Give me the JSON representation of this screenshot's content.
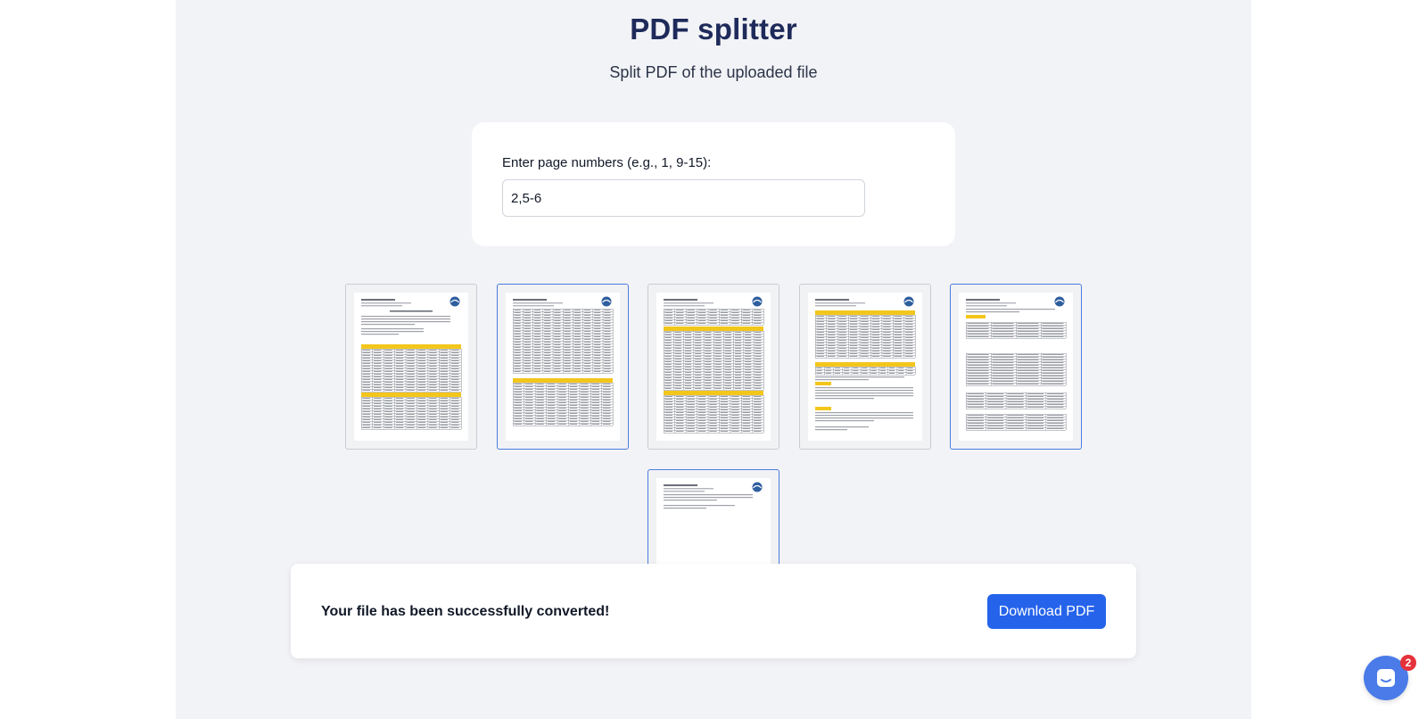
{
  "header": {
    "title": "PDF splitter",
    "subtitle": "Split PDF of the uploaded file"
  },
  "form": {
    "label": "Enter page numbers (e.g., 1, 9-15):",
    "value": "2,5-6"
  },
  "pages": [
    {
      "page": 1,
      "selected": false
    },
    {
      "page": 2,
      "selected": true
    },
    {
      "page": 3,
      "selected": false
    },
    {
      "page": 4,
      "selected": false
    },
    {
      "page": 5,
      "selected": true
    },
    {
      "page": 6,
      "selected": true
    }
  ],
  "result": {
    "message": "Your file has been successfully converted!",
    "download_label": "Download PDF"
  },
  "chat": {
    "badge_count": "2",
    "icon": "chat-icon"
  },
  "colors": {
    "accent": "#2563eb",
    "title": "#1e2a5a",
    "selected_border": "#4b7be0",
    "doc_highlight": "#f3c61c",
    "badge": "#e5323a"
  }
}
